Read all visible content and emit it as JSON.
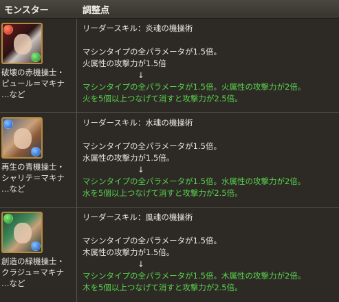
{
  "header": {
    "col_monster": "モンスター",
    "col_adjust": "調整点"
  },
  "rows": [
    {
      "name_lines": [
        "破壊の赤機操士・",
        "ピュール＝マキナ",
        "…など"
      ],
      "leader_skill": "リーダースキル：炎魂の機操術",
      "before1": "マシンタイプの全パラメータが1.5倍。",
      "before2": "火属性の攻撃力が1.5倍",
      "arrow": "↓",
      "after1": "マシンタイプの全パラメータが1.5倍。火属性の攻撃力が2倍。",
      "after2": "火を5個以上つなげて消すと攻撃力が2.5倍。",
      "orb_top": "red-orb-icon",
      "orb_bottom": "green-orb-icon"
    },
    {
      "name_lines": [
        "再生の青機操士・",
        "シャリテ＝マキナ",
        "…など"
      ],
      "leader_skill": "リーダースキル：水魂の機操術",
      "before1": "マシンタイプの全パラメータが1.5倍。",
      "before2": "水属性の攻撃力が1.5倍。",
      "arrow": "↓",
      "after1": "マシンタイプの全パラメータが1.5倍。水属性の攻撃力が2倍。",
      "after2": "水を5個以上つなげて消すと攻撃力が2.5倍。",
      "orb_top": "blue-orb-icon",
      "orb_bottom": "blue-orb-icon"
    },
    {
      "name_lines": [
        "創造の緑機操士・",
        "クラジュ＝マキナ",
        "…など"
      ],
      "leader_skill": "リーダースキル：風魂の機操術",
      "before1": "マシンタイプの全パラメータが1.5倍。",
      "before2": "木属性の攻撃力が1.5倍。",
      "arrow": "↓",
      "after1": "マシンタイプの全パラメータが1.5倍。木属性の攻撃力が2倍。",
      "after2": "木を5個以上つなげて消すと攻撃力が2.5倍。",
      "orb_top": "green-orb-icon",
      "orb_bottom": "blue-orb-icon"
    }
  ],
  "colors": {
    "accent_green": "#58d24a",
    "background": "#2d2a26"
  }
}
